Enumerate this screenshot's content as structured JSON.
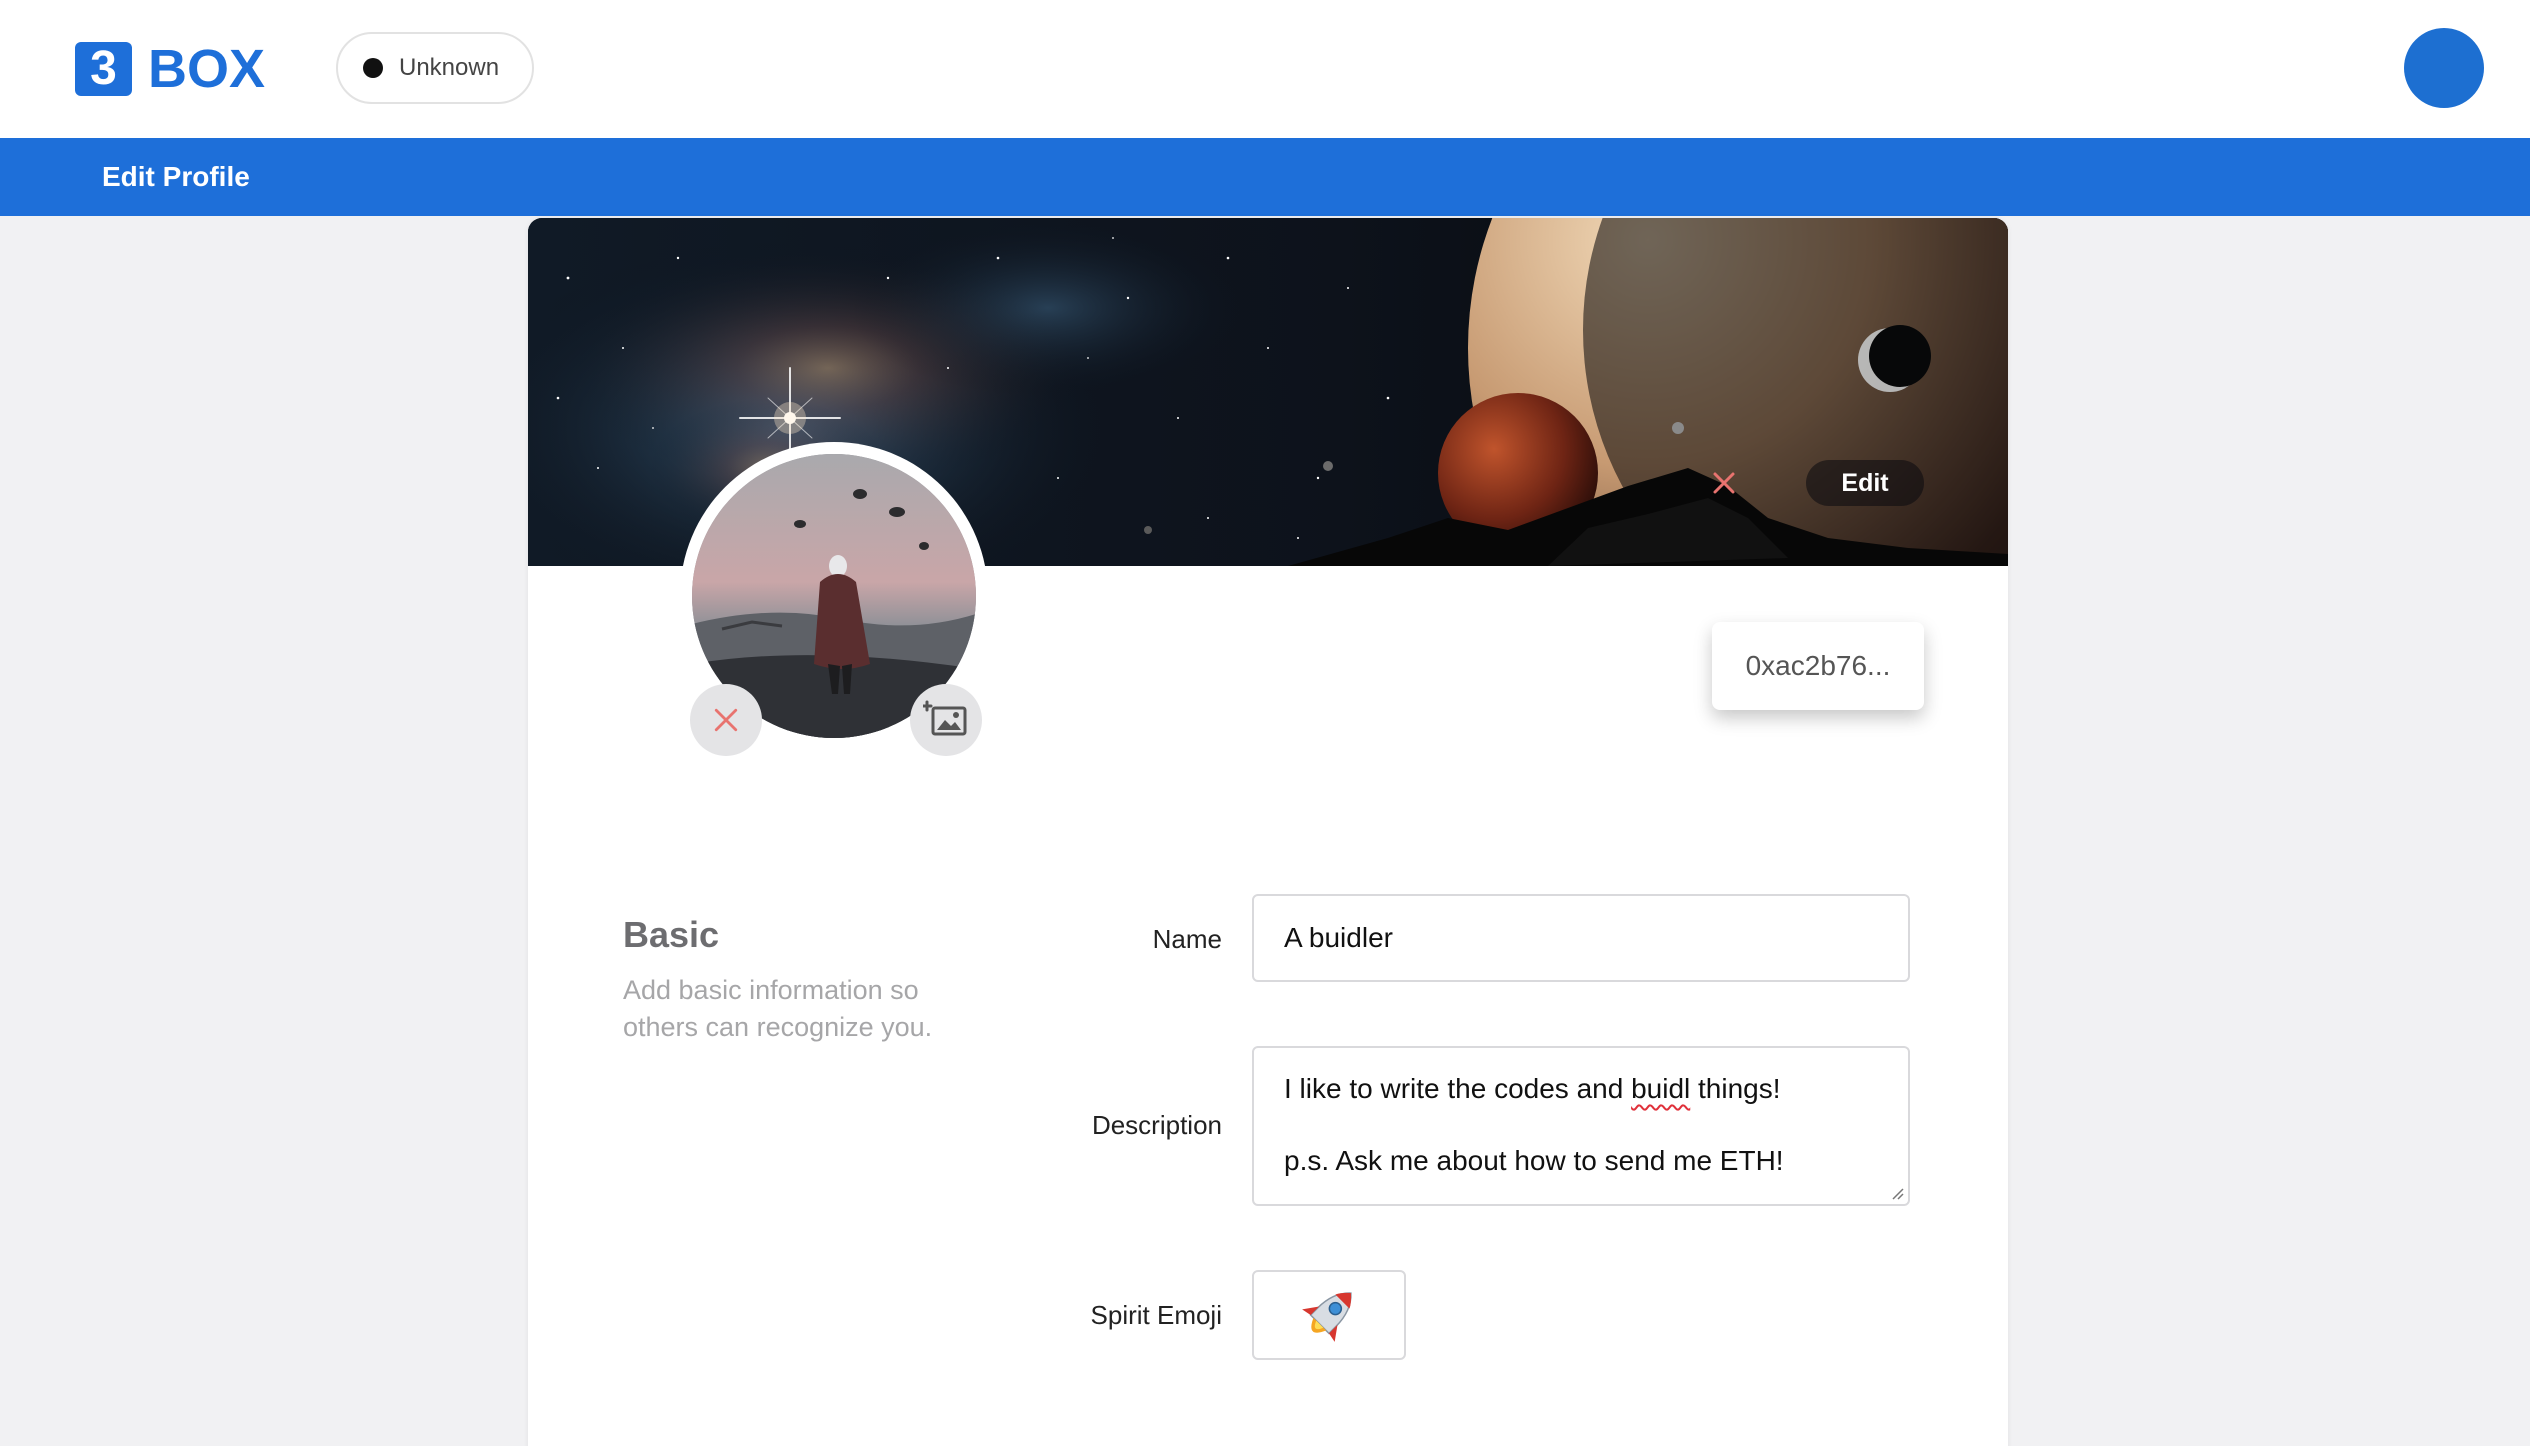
{
  "header": {
    "logo_mark": "3",
    "logo_text": "BOX",
    "network_status": "Unknown"
  },
  "subnav": {
    "title": "Edit Profile"
  },
  "cover": {
    "edit_label": "Edit"
  },
  "profile": {
    "address": "0xac2b76..."
  },
  "basic_section": {
    "title": "Basic",
    "description": "Add basic information so others can recognize you.",
    "fields": {
      "name_label": "Name",
      "name_value": "A buidler",
      "description_label": "Description",
      "description_line1_pre": "I like to write the codes and ",
      "description_line1_misspelled": "buidl",
      "description_line1_post": " things!",
      "description_line2": "p.s. Ask me about how to send me ETH!",
      "emoji_label": "Spirit Emoji",
      "emoji_value": "🚀"
    }
  },
  "colors": {
    "brand_blue": "#1e6fd9",
    "remove_red": "#e8736f",
    "page_bg": "#f1f1f3"
  },
  "icons": {
    "cover_remove": "close-icon",
    "avatar_remove": "close-icon",
    "avatar_upload": "add-image-icon",
    "network_status": "status-dot-icon"
  }
}
